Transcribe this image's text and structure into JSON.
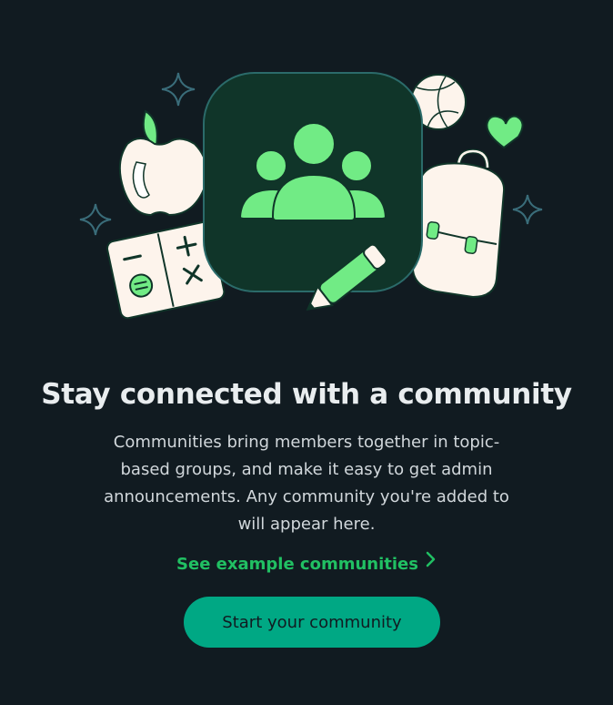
{
  "hero": {
    "title": "Stay connected with a community",
    "description": "Communities bring members together in topic-based groups, and make it easy to get admin announcements. Any community you're added to will appear here."
  },
  "actions": {
    "example_link_label": "See example communities",
    "start_button_label": "Start your community"
  },
  "icons": {
    "illustration": "community-illustration",
    "link_chevron": "chevron-right-icon"
  },
  "colors": {
    "background": "#111b21",
    "accent_green": "#21c063",
    "button": "#00a884",
    "illustration_green": "#71eb85",
    "illustration_dark": "#103529",
    "cream": "#fdf4ec"
  }
}
